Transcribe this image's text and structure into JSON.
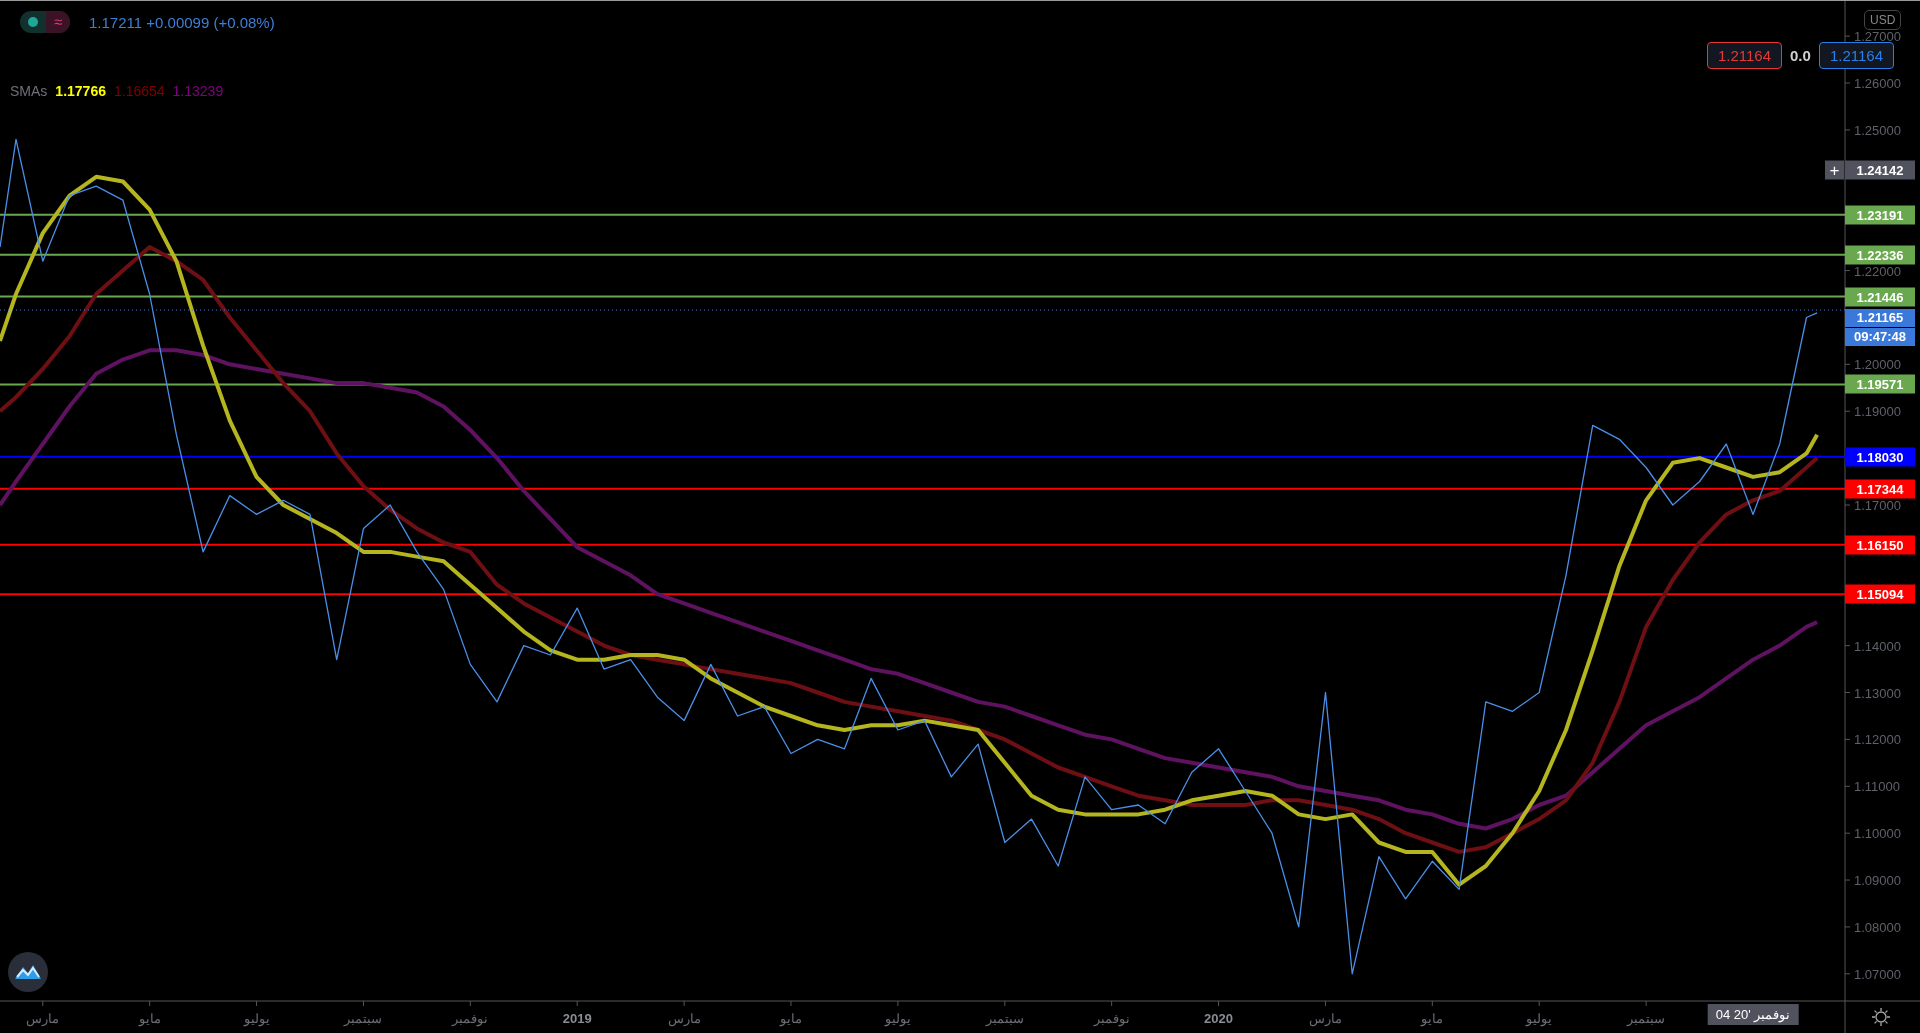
{
  "header": {
    "toggle_icon": "≈",
    "quote": "1.17211 +0.00099 (+0.08%)"
  },
  "indicator": {
    "label": "SMAs",
    "values": [
      {
        "text": "1.17766",
        "color": "#ffff00"
      },
      {
        "text": "1.16654",
        "color": "#800000"
      },
      {
        "text": "1.13239",
        "color": "#800080"
      }
    ]
  },
  "trade": {
    "sell": "1.21164",
    "spread": "0.0",
    "buy": "1.21164"
  },
  "currency": "USD",
  "chart_data": {
    "type": "line",
    "xlim": [
      2018.1,
      2021.0937
    ],
    "ylim": [
      1.0642,
      1.2775
    ],
    "x": [
      2018.1,
      2018.125,
      2018.1667,
      2018.2083,
      2018.25,
      2018.2917,
      2018.3333,
      2018.375,
      2018.4167,
      2018.4583,
      2018.5,
      2018.5417,
      2018.5833,
      2018.625,
      2018.6667,
      2018.7083,
      2018.75,
      2018.7917,
      2018.8333,
      2018.875,
      2018.9167,
      2018.9583,
      2019,
      2019.0417,
      2019.0833,
      2019.125,
      2019.1667,
      2019.2083,
      2019.25,
      2019.2917,
      2019.3333,
      2019.375,
      2019.4167,
      2019.4583,
      2019.5,
      2019.5417,
      2019.5833,
      2019.625,
      2019.6667,
      2019.7083,
      2019.75,
      2019.7917,
      2019.8333,
      2019.875,
      2019.9167,
      2019.9583,
      2020,
      2020.0417,
      2020.0833,
      2020.125,
      2020.1667,
      2020.2083,
      2020.25,
      2020.2917,
      2020.3333,
      2020.375,
      2020.4167,
      2020.4583,
      2020.5,
      2020.5417,
      2020.5833,
      2020.625,
      2020.6667,
      2020.7083,
      2020.75,
      2020.7917,
      2020.8333,
      2020.875,
      2020.9167,
      2020.9333
    ],
    "series": [
      {
        "color": "#5e1260",
        "values": [
          1.17,
          1.175,
          1.183,
          1.191,
          1.198,
          1.201,
          1.203,
          1.203,
          1.202,
          1.2,
          1.199,
          1.198,
          1.197,
          1.196,
          1.196,
          1.195,
          1.194,
          1.191,
          1.186,
          1.18,
          1.173,
          1.167,
          1.161,
          1.158,
          1.155,
          1.151,
          1.149,
          1.147,
          1.145,
          1.143,
          1.141,
          1.139,
          1.137,
          1.135,
          1.134,
          1.132,
          1.13,
          1.128,
          1.127,
          1.125,
          1.123,
          1.121,
          1.12,
          1.118,
          1.116,
          1.115,
          1.114,
          1.113,
          1.112,
          1.11,
          1.109,
          1.108,
          1.107,
          1.105,
          1.104,
          1.102,
          1.101,
          1.103,
          1.106,
          1.108,
          1.113,
          1.118,
          1.123,
          1.126,
          1.129,
          1.133,
          1.137,
          1.14,
          1.144,
          1.145
        ]
      },
      {
        "color": "#6e0f14",
        "values": [
          1.19,
          1.193,
          1.199,
          1.206,
          1.215,
          1.22,
          1.225,
          1.222,
          1.218,
          1.21,
          1.203,
          1.196,
          1.19,
          1.181,
          1.174,
          1.169,
          1.165,
          1.162,
          1.16,
          1.153,
          1.149,
          1.146,
          1.143,
          1.14,
          1.138,
          1.137,
          1.136,
          1.135,
          1.134,
          1.133,
          1.132,
          1.13,
          1.128,
          1.127,
          1.126,
          1.125,
          1.124,
          1.122,
          1.12,
          1.117,
          1.114,
          1.112,
          1.11,
          1.108,
          1.107,
          1.106,
          1.106,
          1.106,
          1.107,
          1.107,
          1.106,
          1.105,
          1.103,
          1.1,
          1.098,
          1.096,
          1.097,
          1.1,
          1.103,
          1.107,
          1.115,
          1.128,
          1.144,
          1.154,
          1.162,
          1.168,
          1.171,
          1.173,
          1.178,
          1.18
        ]
      },
      {
        "color": "#b5b520",
        "values": [
          1.205,
          1.215,
          1.228,
          1.236,
          1.24,
          1.239,
          1.233,
          1.222,
          1.204,
          1.188,
          1.176,
          1.17,
          1.167,
          1.164,
          1.16,
          1.16,
          1.159,
          1.158,
          1.153,
          1.148,
          1.143,
          1.139,
          1.137,
          1.137,
          1.138,
          1.138,
          1.137,
          1.133,
          1.13,
          1.127,
          1.125,
          1.123,
          1.122,
          1.123,
          1.123,
          1.124,
          1.123,
          1.122,
          1.115,
          1.108,
          1.105,
          1.104,
          1.104,
          1.104,
          1.105,
          1.107,
          1.108,
          1.109,
          1.108,
          1.104,
          1.103,
          1.104,
          1.098,
          1.096,
          1.096,
          1.089,
          1.093,
          1.1,
          1.109,
          1.122,
          1.139,
          1.157,
          1.171,
          1.179,
          1.18,
          1.178,
          1.176,
          1.177,
          1.181,
          1.185
        ]
      },
      {
        "color": "#4a8fe8",
        "values": [
          1.225,
          1.248,
          1.222,
          1.236,
          1.238,
          1.235,
          1.215,
          1.185,
          1.16,
          1.172,
          1.168,
          1.171,
          1.168,
          1.137,
          1.165,
          1.17,
          1.16,
          1.152,
          1.136,
          1.128,
          1.14,
          1.138,
          1.148,
          1.135,
          1.137,
          1.129,
          1.124,
          1.136,
          1.125,
          1.127,
          1.117,
          1.12,
          1.118,
          1.133,
          1.122,
          1.124,
          1.112,
          1.119,
          1.098,
          1.103,
          1.093,
          1.112,
          1.105,
          1.106,
          1.102,
          1.113,
          1.118,
          1.109,
          1.1,
          1.08,
          1.13,
          1.07,
          1.095,
          1.086,
          1.094,
          1.088,
          1.128,
          1.126,
          1.13,
          1.155,
          1.187,
          1.184,
          1.178,
          1.17,
          1.175,
          1.183,
          1.168,
          1.183,
          1.21,
          1.211
        ]
      }
    ],
    "xticks": [
      {
        "value": 2018.1667,
        "label": "مارس"
      },
      {
        "value": 2018.3333,
        "label": "مايو"
      },
      {
        "value": 2018.5,
        "label": "يوليو"
      },
      {
        "value": 2018.6667,
        "label": "سبتمبر"
      },
      {
        "value": 2018.8333,
        "label": "نوفمبر"
      },
      {
        "value": 2019,
        "label": "2019"
      },
      {
        "value": 2019.1667,
        "label": "مارس"
      },
      {
        "value": 2019.3333,
        "label": "مايو"
      },
      {
        "value": 2019.5,
        "label": "يوليو"
      },
      {
        "value": 2019.6667,
        "label": "سبتمبر"
      },
      {
        "value": 2019.8333,
        "label": "نوفمبر"
      },
      {
        "value": 2020,
        "label": "2020"
      },
      {
        "value": 2020.1667,
        "label": "مارس"
      },
      {
        "value": 2020.3333,
        "label": "مايو"
      },
      {
        "value": 2020.5,
        "label": "يوليو"
      },
      {
        "value": 2020.6667,
        "label": "سبتمبر"
      }
    ],
    "yticks": [
      {
        "value": 1.27,
        "label": "1.27000"
      },
      {
        "value": 1.26,
        "label": "1.26000"
      },
      {
        "value": 1.25,
        "label": "1.25000"
      },
      {
        "value": 1.22,
        "label": "1.22000"
      },
      {
        "value": 1.2,
        "label": "1.20000"
      },
      {
        "value": 1.19,
        "label": "1.19000"
      },
      {
        "value": 1.17,
        "label": "1.17000"
      },
      {
        "value": 1.14,
        "label": "1.14000"
      },
      {
        "value": 1.13,
        "label": "1.13000"
      },
      {
        "value": 1.12,
        "label": "1.12000"
      },
      {
        "value": 1.11,
        "label": "1.11000"
      },
      {
        "value": 1.1,
        "label": "1.10000"
      },
      {
        "value": 1.09,
        "label": "1.09000"
      },
      {
        "value": 1.08,
        "label": "1.08000"
      },
      {
        "value": 1.07,
        "label": "1.07000"
      }
    ],
    "ref_lines": [
      {
        "axis": "y",
        "value": 1.23191,
        "label": "1.23191",
        "color": "#6aa84f"
      },
      {
        "axis": "y",
        "value": 1.22336,
        "label": "1.22336",
        "color": "#6aa84f"
      },
      {
        "axis": "y",
        "value": 1.21446,
        "label": "1.21446",
        "color": "#6aa84f"
      },
      {
        "axis": "y",
        "value": 1.19571,
        "label": "1.19571",
        "color": "#6aa84f"
      },
      {
        "axis": "y",
        "value": 1.1803,
        "label": "1.18030",
        "color": "#0000ff"
      },
      {
        "axis": "y",
        "value": 1.17344,
        "label": "1.17344",
        "color": "#ff0000"
      },
      {
        "axis": "y",
        "value": 1.1615,
        "label": "1.16150",
        "color": "#ff0000"
      },
      {
        "axis": "y",
        "value": 1.15094,
        "label": "1.15094",
        "color": "#ff0000"
      }
    ]
  },
  "last_price": {
    "price": "1.21165",
    "countdown": "09:47:48"
  },
  "crosshair": {
    "price": "1.24142",
    "plus": "+",
    "date": "04 نوفمبر '20"
  }
}
